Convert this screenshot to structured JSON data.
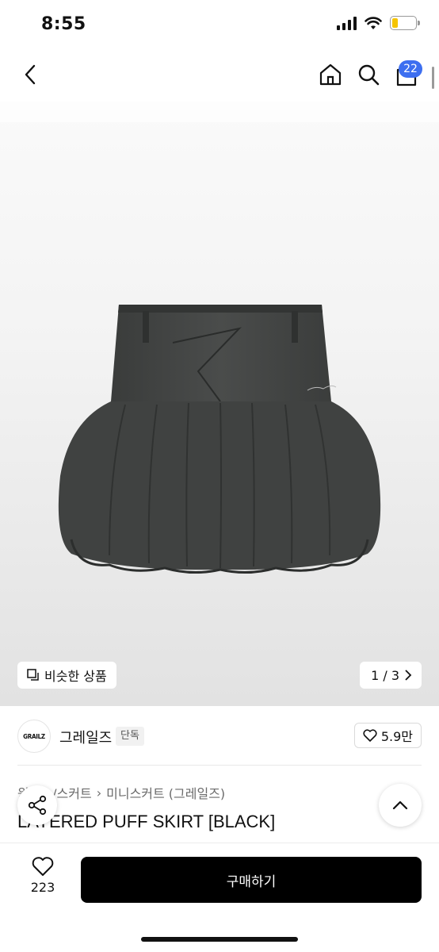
{
  "status_bar": {
    "time": "8:55",
    "battery_level": 0.25
  },
  "nav": {
    "cart_count": "22"
  },
  "image": {
    "similar_label": "비슷한 상품",
    "page_indicator": "1 / 3"
  },
  "brand": {
    "logo_text": "GRAILZ",
    "name": "그레일즈",
    "tag": "단독",
    "likes": "5.9만"
  },
  "product": {
    "breadcrumb": [
      "원피스/스커트",
      "미니스커트 (그레일즈)"
    ],
    "title": "LAYERED PUFF SKIRT [BLACK]"
  },
  "bottom": {
    "wish_count": "223",
    "buy_label": "구매하기"
  },
  "colors": {
    "accent": "#3d6ff0",
    "buy_button": "#000000",
    "battery": "#f5c400"
  }
}
